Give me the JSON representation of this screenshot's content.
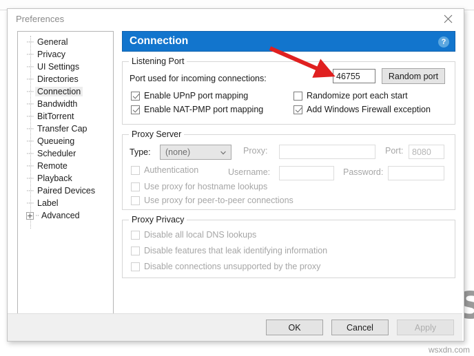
{
  "window": {
    "title": "Preferences",
    "close_label": "close-icon"
  },
  "background": {
    "ghost_text_right": "",
    "ghost_text_left": ""
  },
  "sidebar": {
    "items": [
      {
        "label": "General",
        "selected": false,
        "expandable": false
      },
      {
        "label": "Privacy",
        "selected": false,
        "expandable": false
      },
      {
        "label": "UI Settings",
        "selected": false,
        "expandable": false
      },
      {
        "label": "Directories",
        "selected": false,
        "expandable": false
      },
      {
        "label": "Connection",
        "selected": true,
        "expandable": false
      },
      {
        "label": "Bandwidth",
        "selected": false,
        "expandable": false
      },
      {
        "label": "BitTorrent",
        "selected": false,
        "expandable": false
      },
      {
        "label": "Transfer Cap",
        "selected": false,
        "expandable": false
      },
      {
        "label": "Queueing",
        "selected": false,
        "expandable": false
      },
      {
        "label": "Scheduler",
        "selected": false,
        "expandable": false
      },
      {
        "label": "Remote",
        "selected": false,
        "expandable": false
      },
      {
        "label": "Playback",
        "selected": false,
        "expandable": false
      },
      {
        "label": "Paired Devices",
        "selected": false,
        "expandable": false
      },
      {
        "label": "Label",
        "selected": false,
        "expandable": false
      },
      {
        "label": "Advanced",
        "selected": false,
        "expandable": true
      }
    ]
  },
  "pane": {
    "title": "Connection",
    "help_label": "?",
    "accent_color": "#1275cd"
  },
  "listening_port": {
    "group_title": "Listening Port",
    "port_label": "Port used for incoming connections:",
    "port_value": "46755",
    "random_port_button": "Random port",
    "checkboxes": [
      {
        "label": "Enable UPnP port mapping",
        "checked": true,
        "disabled": false
      },
      {
        "label": "Randomize port each start",
        "checked": false,
        "disabled": false
      },
      {
        "label": "Enable NAT-PMP port mapping",
        "checked": true,
        "disabled": false
      },
      {
        "label": "Add Windows Firewall exception",
        "checked": true,
        "disabled": false
      }
    ]
  },
  "proxy_server": {
    "group_title": "Proxy Server",
    "type_label": "Type:",
    "type_value": "(none)",
    "proxy_label": "Proxy:",
    "proxy_value": "",
    "port_label": "Port:",
    "port_value": "8080",
    "auth_label": "Authentication",
    "auth_checked": false,
    "username_label": "Username:",
    "username_value": "",
    "password_label": "Password:",
    "password_value": "",
    "checkboxes": [
      {
        "label": "Use proxy for hostname lookups",
        "checked": false,
        "disabled": true
      },
      {
        "label": "Use proxy for peer-to-peer connections",
        "checked": false,
        "disabled": true
      }
    ]
  },
  "proxy_privacy": {
    "group_title": "Proxy Privacy",
    "checkboxes": [
      {
        "label": "Disable all local DNS lookups",
        "checked": false,
        "disabled": true
      },
      {
        "label": "Disable features that leak identifying information",
        "checked": false,
        "disabled": true
      },
      {
        "label": "Disable connections unsupported by the proxy",
        "checked": false,
        "disabled": true
      }
    ]
  },
  "footer": {
    "ok_label": "OK",
    "cancel_label": "Cancel",
    "apply_label": "Apply",
    "apply_disabled": true
  },
  "watermark": {
    "brand": "APPUALS",
    "site": "wsxdn.com"
  },
  "annotation": {
    "arrow_color": "#e02020"
  }
}
